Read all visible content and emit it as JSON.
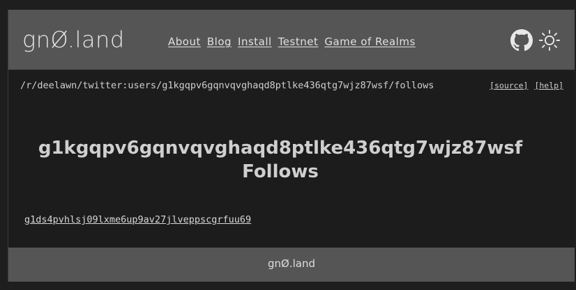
{
  "header": {
    "logo": "gnØ.land",
    "nav": [
      "About",
      "Blog",
      "Install",
      "Testnet",
      "Game of Realms"
    ],
    "icons": [
      "github-icon",
      "sun-icon"
    ]
  },
  "pathbar": {
    "path": "/r/deelawn/twitter:users/g1kgqpv6gqnvqvghaqd8ptlke436qtg7wjz87wsf/follows",
    "source": "[source]",
    "help": "[help]"
  },
  "content": {
    "title_line1": "g1kgqpv6gqnvqvghaqd8ptlke436qtg7wjz87wsf",
    "title_line2": "Follows",
    "follows": [
      "g1ds4pvhlsj09lxme6up9av27jlveppscgrfuu69"
    ]
  },
  "footer": {
    "logo": "gnØ.land"
  }
}
